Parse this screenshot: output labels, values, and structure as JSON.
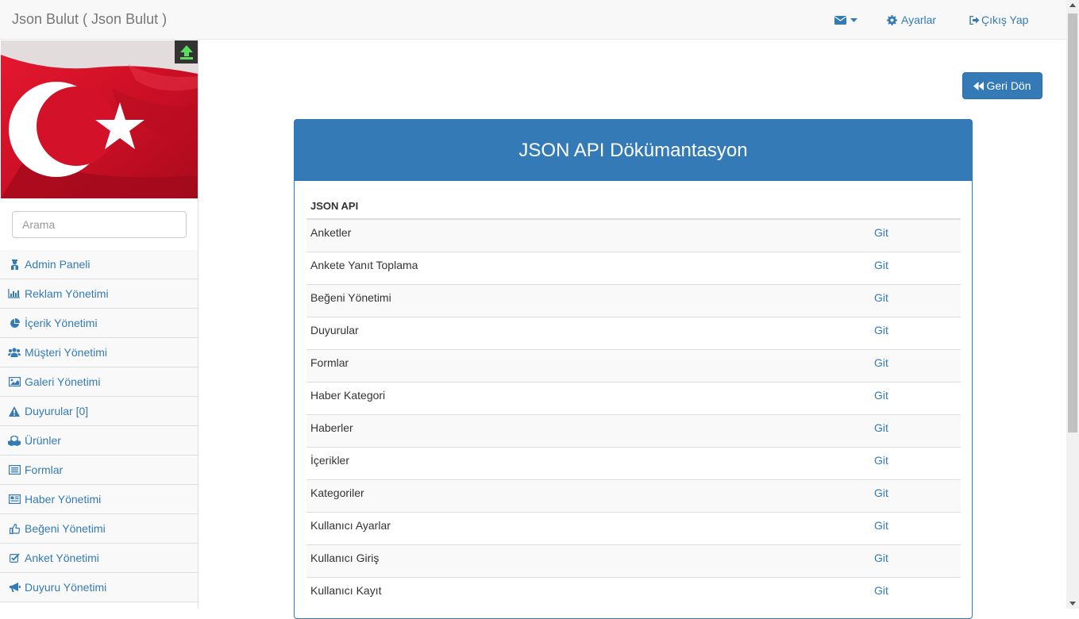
{
  "navbar": {
    "brand": "Json Bulut ( Json Bulut )",
    "settings_label": "Ayarlar",
    "logout_label": "Çıkış Yap"
  },
  "sidebar": {
    "search_placeholder": "Arama",
    "items": [
      {
        "label": "Admin Paneli",
        "icon": "user-secret-icon"
      },
      {
        "label": "Reklam Yönetimi",
        "icon": "bar-chart-icon"
      },
      {
        "label": "İçerik Yönetimi",
        "icon": "pie-chart-icon"
      },
      {
        "label": "Müşteri Yönetimi",
        "icon": "users-icon"
      },
      {
        "label": "Galeri Yönetimi",
        "icon": "image-icon"
      },
      {
        "label": "Duyurular [0]",
        "icon": "warning-icon"
      },
      {
        "label": "Ürünler",
        "icon": "cubes-icon"
      },
      {
        "label": "Formlar",
        "icon": "list-alt-icon"
      },
      {
        "label": "Haber Yönetimi",
        "icon": "newspaper-icon"
      },
      {
        "label": "Beğeni Yönetimi",
        "icon": "thumbs-up-icon"
      },
      {
        "label": "Anket Yönetimi",
        "icon": "check-square-icon"
      },
      {
        "label": "Duyuru Yönetimi",
        "icon": "bullhorn-icon"
      }
    ]
  },
  "main": {
    "back_label": "Geri Dön",
    "panel_title": "JSON API Dökümantasyon",
    "table_header": "JSON API",
    "rows": [
      {
        "name": "Anketler",
        "link": "Git"
      },
      {
        "name": "Ankete Yanıt Toplama",
        "link": "Git"
      },
      {
        "name": "Beğeni Yönetimi",
        "link": "Git"
      },
      {
        "name": "Duyurular",
        "link": "Git"
      },
      {
        "name": "Formlar",
        "link": "Git"
      },
      {
        "name": "Haber Kategori",
        "link": "Git"
      },
      {
        "name": "Haberler",
        "link": "Git"
      },
      {
        "name": "İçerikler",
        "link": "Git"
      },
      {
        "name": "Kategoriler",
        "link": "Git"
      },
      {
        "name": "Kullanıcı Ayarlar",
        "link": "Git"
      },
      {
        "name": "Kullanıcı Giriş",
        "link": "Git"
      },
      {
        "name": "Kullanıcı Kayıt",
        "link": "Git"
      }
    ]
  },
  "colors": {
    "primary": "#337ab7",
    "upload_green": "#5cdc5c",
    "flag_red": "#d9142b"
  }
}
